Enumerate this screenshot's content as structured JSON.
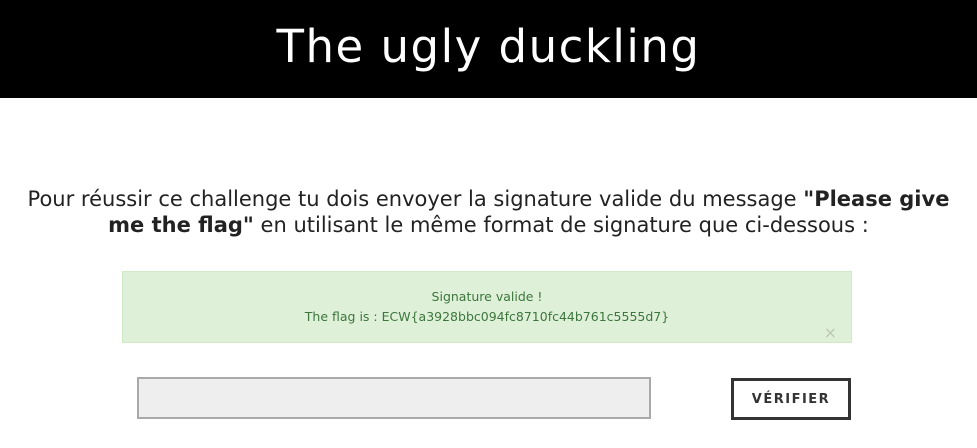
{
  "header": {
    "title": "The ugly duckling"
  },
  "instructions": {
    "text_before": "Pour réussir ce challenge tu dois envoyer la signature valide du message ",
    "highlight_part1": "\"Please give",
    "highlight_part2": "me the flag\"",
    "text_after": " en utilisant le même format de signature que ci-dessous :"
  },
  "alert": {
    "line1": "Signature valide !",
    "line2": "The flag is : ECW{a3928bbc094fc8710fc44b761c5555d7}",
    "close_glyph": "×",
    "colors": {
      "background": "#dff0d8",
      "text": "#3c763d"
    }
  },
  "form": {
    "signature_value": "",
    "signature_placeholder": "",
    "verify_label": "VÉRIFIER"
  }
}
